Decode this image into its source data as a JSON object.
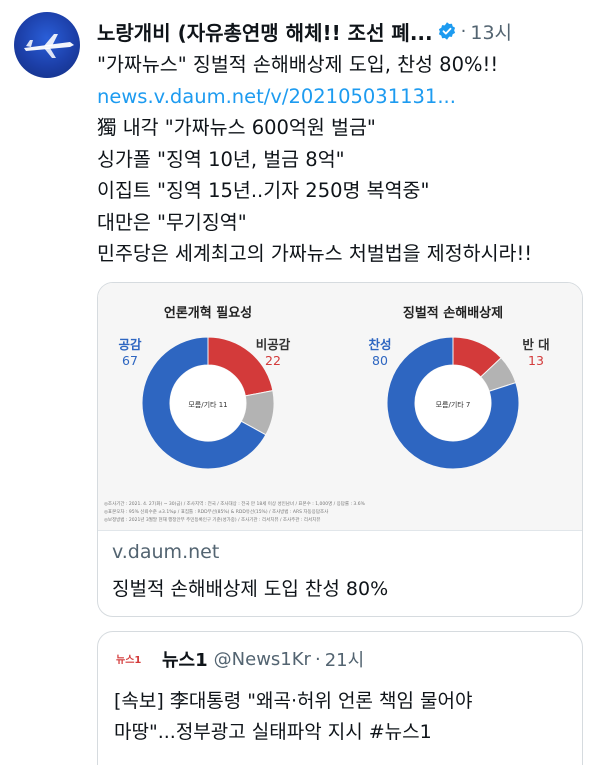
{
  "colors": {
    "accent": "#1d9bf0",
    "agree": "#2e66c1",
    "disagree": "#d33a3a",
    "unknown": "#b3b3b3"
  },
  "tweet": {
    "display_name": "노랑개비 (자유총연맹 해체!! 조선 폐...",
    "verified_icon": "verified-badge-icon",
    "time": "13시",
    "lines": [
      "\"가짜뉴스\" 징벌적 손해배상제 도입, 찬성 80%!!",
      "news.v.daum.net/v/202105031131...",
      "獨 내각 \"가짜뉴스 600억원 벌금\"",
      "싱가폴 \"징역 10년, 벌금 8억\"",
      "이집트 \"징역 15년..기자 250명 복역중\"",
      "대만은 \"무기징역\"",
      "민주당은 세계최고의 가짜뉴스 처벌법을 제정하시라!!"
    ]
  },
  "card": {
    "domain": "v.daum.net",
    "title": "징벌적 손해배상제 도입 찬성 80%",
    "footnote_lines": [
      "◎조사기간 : 2021. 4. 27(화) ~ 30(금)  / 조사지역 : 전국  / 조사대상 : 전국 만 18세 이상 성인남녀  / 표본수 : 1,000명  / 응답률 : 3.6%",
      "◎표본오차 : 95% 신뢰수준 ±3.1%p  / 표집틀 : RDD무선(85%) & RDD유선(15%)  / 조사방법 : ARS 자동응답조사",
      "◎보정방법 : 2021년 3월말 현재 행정안부 주민등록인구 기준(성가중)  / 조사기관 : 리서치뷰  / 조사주관 : 리서치뷰"
    ]
  },
  "chart_data": [
    {
      "type": "pie",
      "title": "언론개혁 필요성",
      "center_label": "모름/기타 11",
      "categories": [
        "공감",
        "비공감",
        "모름/기타"
      ],
      "values": [
        67,
        22,
        11
      ]
    },
    {
      "type": "pie",
      "title": "징벌적 손해배상제",
      "center_label": "모름/기타 7",
      "categories": [
        "찬성",
        "반 대",
        "모름/기타"
      ],
      "values": [
        80,
        13,
        7
      ]
    }
  ],
  "quote": {
    "logo_text": "뉴스1",
    "name": "뉴스1",
    "handle": "@News1Kr",
    "time": "21시",
    "lines": [
      "[속보] 李대통령 \"왜곡·허위 언론 책임 물어야",
      "마땅\"...정부광고 실태파악 지시 #뉴스1"
    ]
  }
}
